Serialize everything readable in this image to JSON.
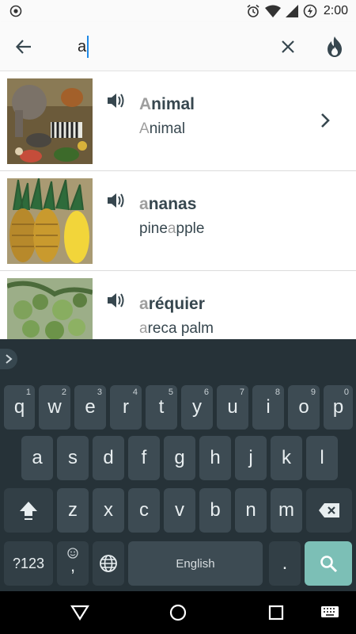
{
  "status_bar": {
    "time": "2:00",
    "icons": [
      "record-icon",
      "alarm-icon",
      "wifi-icon",
      "signal-icon",
      "battery-charging-icon"
    ]
  },
  "search": {
    "value": "a",
    "icons": [
      "back-arrow-icon",
      "clear-icon",
      "fire-icon"
    ]
  },
  "results": [
    {
      "word_match": "A",
      "word_rest": "nimal",
      "trans_match": "A",
      "trans_rest": "nimal",
      "has_arrow": true,
      "image": "animals-photo"
    },
    {
      "word_match": "a",
      "word_rest": "nanas",
      "trans_pre": "pine",
      "trans_match": "a",
      "trans_rest": "pple",
      "image": "pineapple-photo"
    },
    {
      "word_match": "a",
      "word_rest": "réquier",
      "trans_match": "a",
      "trans_rest": "reca palm",
      "image": "areca-palm-photo"
    }
  ],
  "keyboard": {
    "row1": [
      {
        "k": "q",
        "h": "1"
      },
      {
        "k": "w",
        "h": "2"
      },
      {
        "k": "e",
        "h": "3"
      },
      {
        "k": "r",
        "h": "4"
      },
      {
        "k": "t",
        "h": "5"
      },
      {
        "k": "y",
        "h": "6"
      },
      {
        "k": "u",
        "h": "7"
      },
      {
        "k": "i",
        "h": "8"
      },
      {
        "k": "o",
        "h": "9"
      },
      {
        "k": "p",
        "h": "0"
      }
    ],
    "row2": [
      "a",
      "s",
      "d",
      "f",
      "g",
      "h",
      "j",
      "k",
      "l"
    ],
    "row3": [
      "z",
      "x",
      "c",
      "v",
      "b",
      "n",
      "m"
    ],
    "symbols_label": "?123",
    "emoji_comma_label": ",",
    "space_label": "English",
    "period_label": "."
  },
  "colors": {
    "accent_cursor": "#1e88e5",
    "match_highlight": "#9e9e9e",
    "text": "#37474f",
    "keyboard_bg": "#263238",
    "key_bg": "#3d4b53",
    "search_key": "#7cbfb6"
  }
}
